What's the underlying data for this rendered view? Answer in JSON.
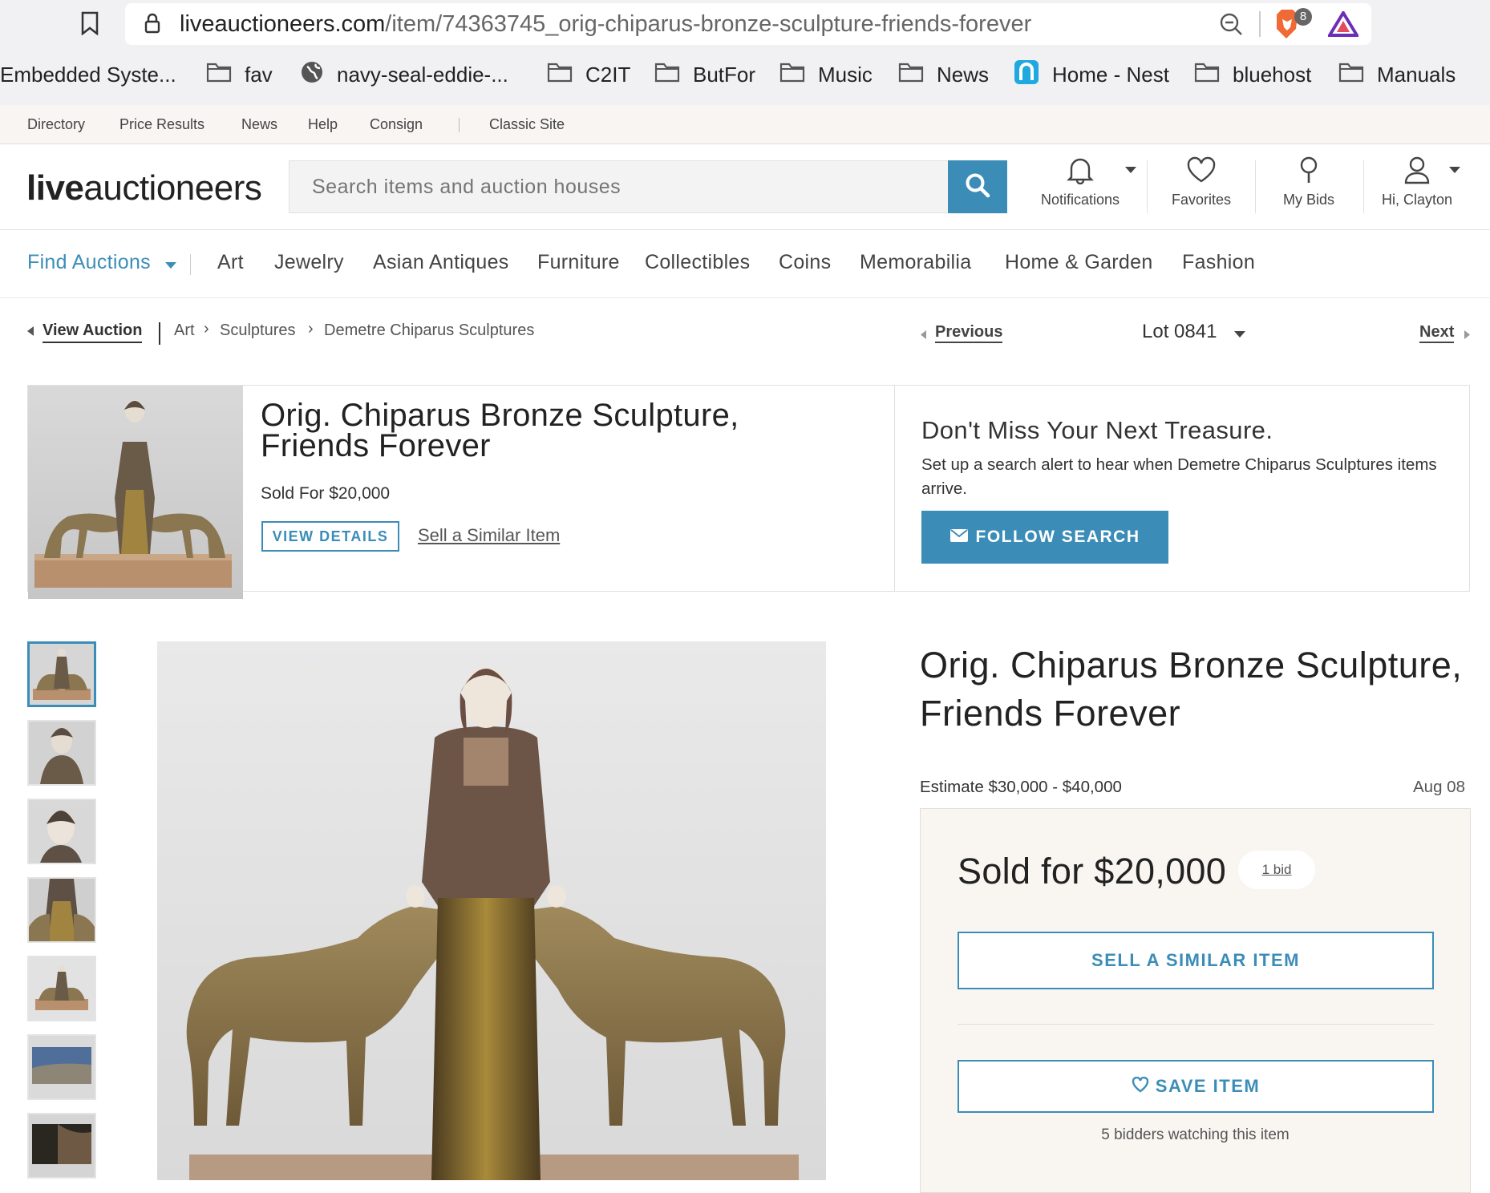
{
  "browser": {
    "url_domain": "liveauctioneers.com",
    "url_path": "/item/74363745_orig-chiparus-bronze-sculpture-friends-forever",
    "extension_badge": "8",
    "bookmarks": [
      "Embedded Syste...",
      "fav",
      "navy-seal-eddie-...",
      "C2IT",
      "ButFor",
      "Music",
      "News",
      "Home - Nest",
      "bluehost",
      "Manuals"
    ]
  },
  "util_nav": [
    "Directory",
    "Price Results",
    "News",
    "Help",
    "Consign",
    "Classic Site"
  ],
  "header": {
    "logo_bold": "live",
    "logo_light": "auctioneers",
    "search_placeholder": "Search items and auction houses",
    "icons": {
      "notifications": "Notifications",
      "favorites": "Favorites",
      "my_bids": "My Bids",
      "account": "Hi, Clayton"
    }
  },
  "category_nav": {
    "find_auctions": "Find Auctions",
    "items": [
      "Art",
      "Jewelry",
      "Asian Antiques",
      "Furniture",
      "Collectibles",
      "Coins",
      "Memorabilia",
      "Home & Garden",
      "Fashion"
    ]
  },
  "breadcrumb": {
    "view_auction": "View Auction",
    "path": [
      "Art",
      "Sculptures",
      "Demetre Chiparus Sculptures"
    ],
    "previous": "Previous",
    "lot": "Lot 0841",
    "next": "Next"
  },
  "summary": {
    "title": "Orig. Chiparus Bronze Sculpture, Friends Forever",
    "sold_for": "Sold For $20,000",
    "view_details": "VIEW DETAILS",
    "sell_similar": "Sell a Similar Item",
    "alert_heading": "Don't Miss Your Next Treasure.",
    "alert_text": "Set up a search alert to hear when Demetre Chiparus Sculptures items arrive.",
    "follow_search": "FOLLOW SEARCH"
  },
  "item": {
    "title": "Orig. Chiparus Bronze Sculpture, Friends Forever",
    "estimate": "Estimate $30,000 - $40,000",
    "date": "Aug 08",
    "sold_for": "Sold for $20,000",
    "bids": "1 bid",
    "sell_similar_button": "SELL A SIMILAR ITEM",
    "save_item_button": "SAVE ITEM",
    "watching": "5 bidders watching this item"
  },
  "colors": {
    "accent": "#3b8db8",
    "text": "#222222",
    "panel_bg": "#f9f6f2"
  }
}
